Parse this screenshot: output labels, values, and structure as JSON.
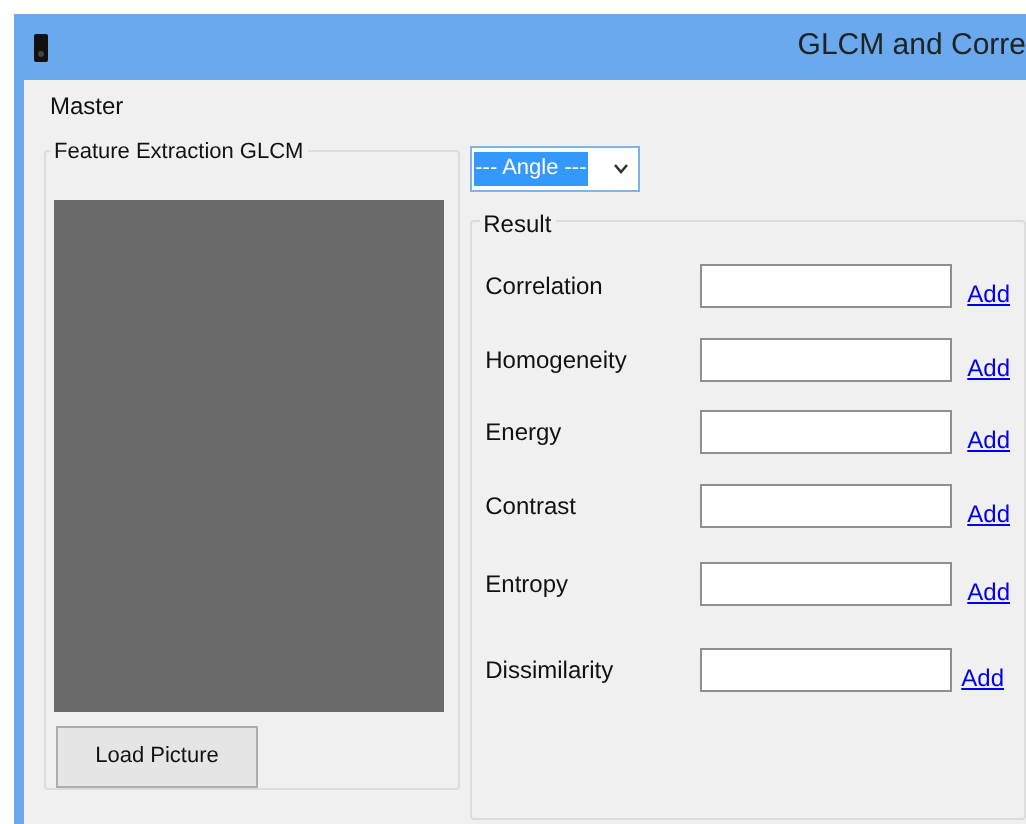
{
  "window": {
    "title": "GLCM and Corre"
  },
  "menu": [
    "Master"
  ],
  "feature_group": {
    "title": "Feature Extraction GLCM",
    "button": "Load Picture"
  },
  "angle_dropdown": {
    "value": "--- Angle ---"
  },
  "result_group": {
    "title": "Result",
    "rows": [
      {
        "label": "Correlation",
        "link": "Add"
      },
      {
        "label": "Homogeneity",
        "link": "Add"
      },
      {
        "label": "Energy",
        "link": "Add"
      },
      {
        "label": "Contrast",
        "link": "Add"
      },
      {
        "label": "Entropy",
        "link": "Add"
      },
      {
        "label": "Dissimilarity",
        "link": "Add"
      }
    ]
  }
}
